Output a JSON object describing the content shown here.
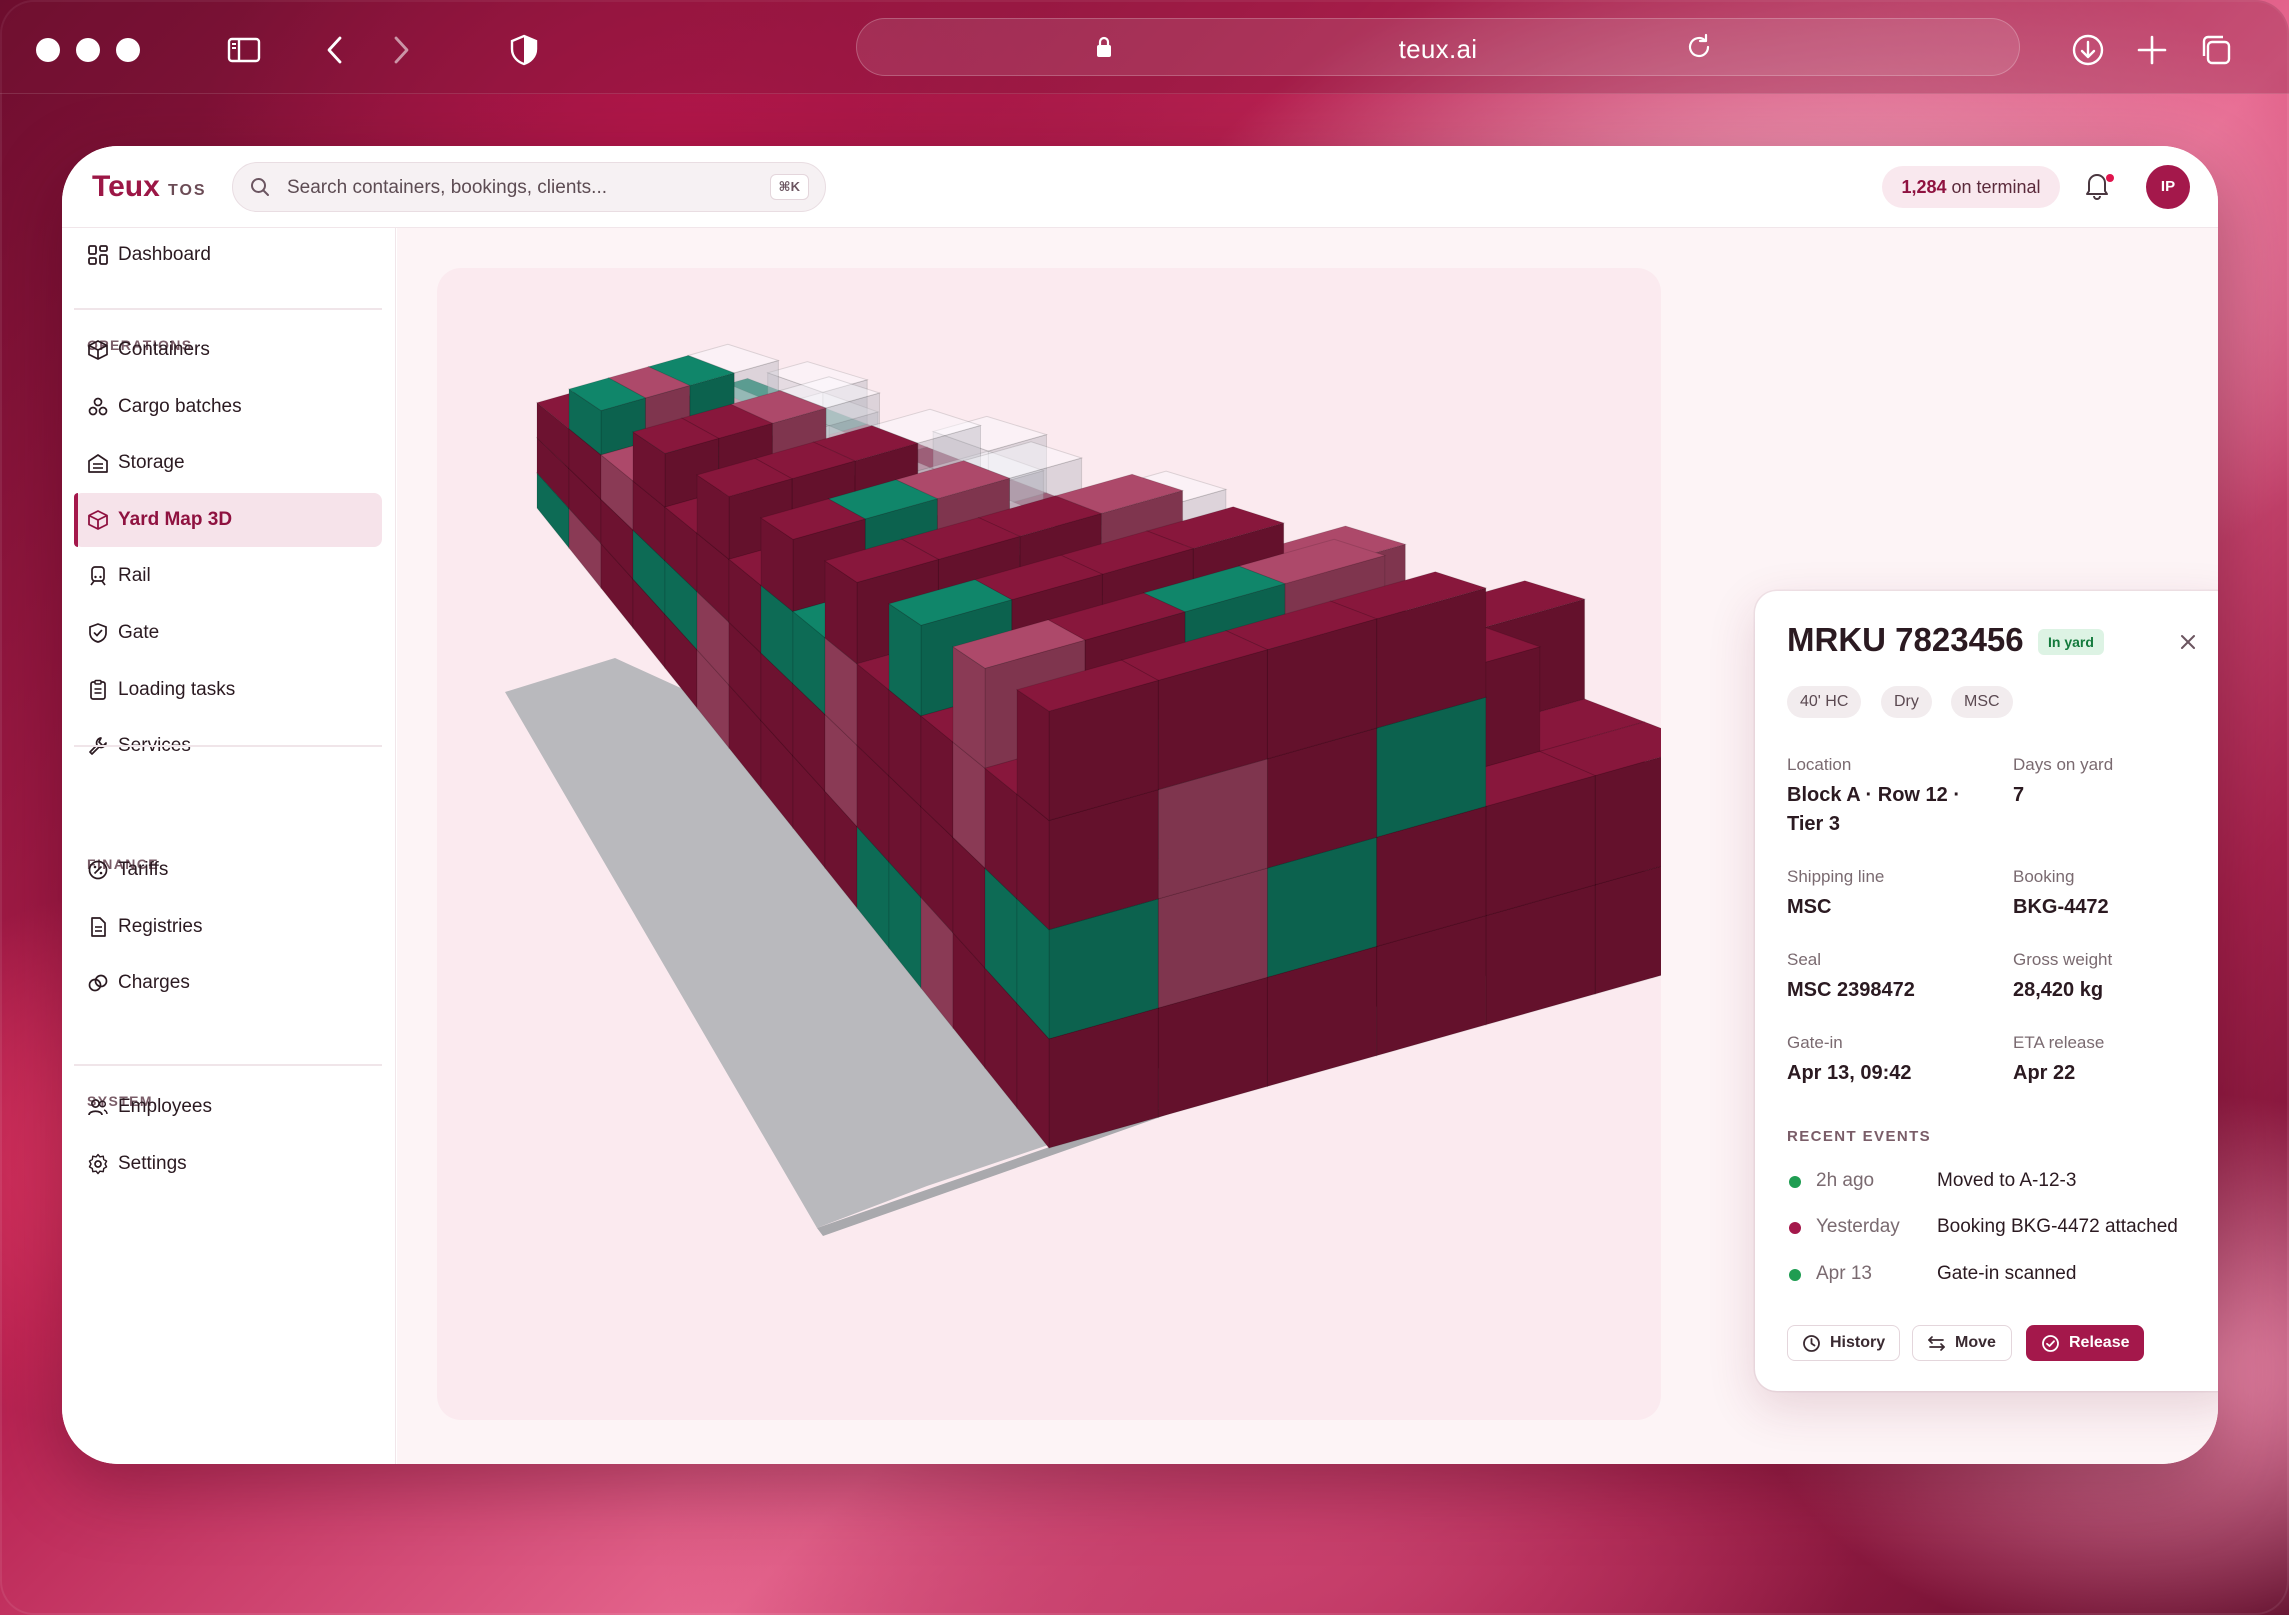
{
  "browser": {
    "url": "teux.ai"
  },
  "app": {
    "logo": "Teux",
    "logo_suffix": "TOS",
    "search_placeholder": "Search containers, bookings, clients...",
    "search_shortcut": "⌘K",
    "terminal_count": "1,284",
    "terminal_suffix": " on terminal",
    "avatar_initials": "IP",
    "accent": "#a4184b"
  },
  "sidebar": {
    "dashboard": "Dashboard",
    "sections": {
      "operations": "OPERATIONS",
      "finance": "FINANCE",
      "system": "SYSTEM"
    },
    "operations": [
      "Containers",
      "Cargo batches",
      "Storage",
      "Yard Map 3D",
      "Rail",
      "Gate",
      "Loading tasks",
      "Services"
    ],
    "finance": [
      "Tariffs",
      "Registries",
      "Charges"
    ],
    "system": [
      "Employees",
      "Settings"
    ],
    "active": "Yard Map 3D"
  },
  "detail": {
    "id": "MRKU 7823456",
    "status": "In yard",
    "tags": [
      "40' HC",
      "Dry",
      "MSC"
    ],
    "fields": {
      "location_label": "Location",
      "location_value_1": "Block A · Row 12 ·",
      "location_value_2": "Tier 3",
      "days_label": "Days on yard",
      "days_value": "7",
      "line_label": "Shipping line",
      "line_value": "MSC",
      "booking_label": "Booking",
      "booking_value": "BKG-4472",
      "seal_label": "Seal",
      "seal_value": "MSC 2398472",
      "weight_label": "Gross weight",
      "weight_value": "28,420 kg",
      "gatein_label": "Gate-in",
      "gatein_value": "Apr 13, 09:42",
      "eta_label": "ETA release",
      "eta_value": "Apr 22"
    },
    "events_title": "RECENT EVENTS",
    "events": [
      {
        "time": "2h ago",
        "text": "Moved to A-12-3",
        "color": "#1f9d52"
      },
      {
        "time": "Yesterday",
        "text": "Booking BKG-4472 attached",
        "color": "#a4184b"
      },
      {
        "time": "Apr 13",
        "text": "Gate-in scanned",
        "color": "#1f9d52"
      }
    ],
    "actions": {
      "history": "History",
      "move": "Move",
      "release": "Release"
    }
  },
  "yard_colors": {
    "maroon": "#6d1230",
    "teal": "#0d6b55",
    "rose": "#8a3a55",
    "ghost": "#c9c9d3"
  }
}
